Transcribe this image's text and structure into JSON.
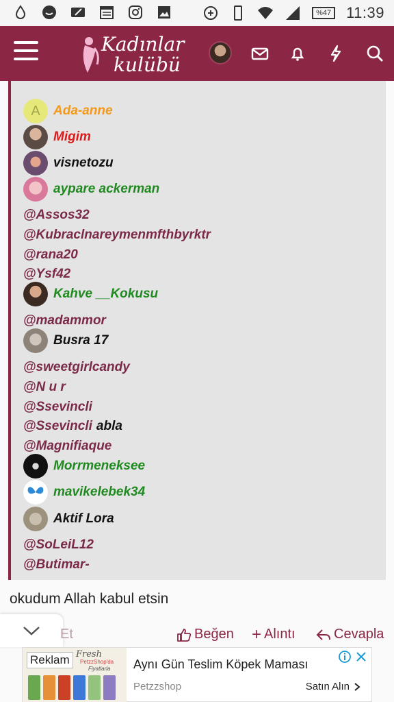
{
  "status_bar": {
    "time": "11:39",
    "battery": "%47",
    "left_icons": [
      "drop-icon",
      "chat-bubble-icon",
      "edit-card-icon",
      "calendar-icon",
      "instagram-icon",
      "image-icon"
    ],
    "right_icons": [
      "data-saver-icon",
      "phone-icon",
      "wifi-icon",
      "signal-icon",
      "battery-icon"
    ]
  },
  "header": {
    "logo_line1": "Kadınlar",
    "logo_line2": "kulübü",
    "brand_color": "#8b2745"
  },
  "quote_list": [
    {
      "type": "user",
      "name": "Ada-anne",
      "color": "orange",
      "avatar_letter": "A"
    },
    {
      "type": "user",
      "name": "Migim",
      "color": "red"
    },
    {
      "type": "user",
      "name": "visnetozu",
      "color": "black"
    },
    {
      "type": "user",
      "name": "aypare ackerman",
      "color": "green"
    },
    {
      "type": "mention",
      "name": "@Assos32"
    },
    {
      "type": "mention",
      "name": "@Kubraclnareymenmfthbyrktr"
    },
    {
      "type": "mention",
      "name": "@rana20"
    },
    {
      "type": "mention",
      "name": "@Ysf42"
    },
    {
      "type": "user",
      "name": "Kahve __Kokusu",
      "color": "green"
    },
    {
      "type": "mention",
      "name": "@madammor"
    },
    {
      "type": "user",
      "name": "Busra 17",
      "color": "black"
    },
    {
      "type": "mention",
      "name": "@sweetgirlcandy"
    },
    {
      "type": "mention",
      "name": "@N u r"
    },
    {
      "type": "mention",
      "name": "@Ssevincli"
    },
    {
      "type": "mention",
      "name": "@Ssevincli",
      "suffix": "abla"
    },
    {
      "type": "mention",
      "name": "@Magnifiaque"
    },
    {
      "type": "user",
      "name": "Morrmeneksee",
      "color": "green"
    },
    {
      "type": "user",
      "name": "mavikelebek34",
      "color": "green"
    },
    {
      "type": "user",
      "name": "Aktif Lora",
      "color": "black"
    },
    {
      "type": "mention",
      "name": "@SoLeiL12"
    },
    {
      "type": "mention",
      "name": "@Butimar-"
    }
  ],
  "post": {
    "text": "okudum Allah kabul etsin"
  },
  "actions": {
    "partial": "Et",
    "like": "Beğen",
    "quote": "Alıntı",
    "reply": "Cevapla"
  },
  "ad": {
    "label": "Reklam",
    "title": "Aynı Gün Teslim Köpek Maması",
    "brand": "Petzzshop",
    "cta": "Satın Alın",
    "image_text_1": "Fresh",
    "image_text_2": "PetzzShop'da",
    "image_text_3": "Fiyatlarla"
  }
}
